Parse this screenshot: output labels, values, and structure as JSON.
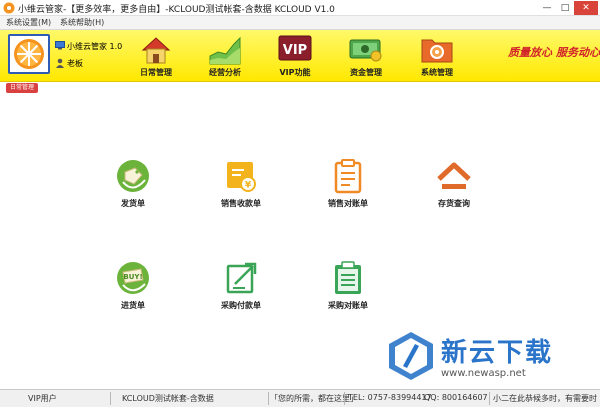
{
  "window": {
    "title": "小维云管家-【更多效率，更多自由】-KCLOUD测试帐套-含数据  KCLOUD V1.0",
    "min_glyph": "—",
    "max_glyph": "□",
    "close_glyph": "✕"
  },
  "menu": {
    "items": [
      "系统设置(M)",
      "系统帮助(H)"
    ]
  },
  "user": {
    "app_name": "小维云管家 1.0",
    "user_name": "老板"
  },
  "toolbar": {
    "buttons": [
      {
        "label": "日常管理",
        "icon": "house-icon"
      },
      {
        "label": "经营分析",
        "icon": "area-chart-icon"
      },
      {
        "label": "VIP功能",
        "icon": "vip-icon"
      },
      {
        "label": "资金管理",
        "icon": "money-icon"
      },
      {
        "label": "系统管理",
        "icon": "system-folder-icon"
      }
    ],
    "slogans": [
      "质量放心",
      "服务动心"
    ],
    "colors": {
      "background": "#ffef30",
      "slogan": "#d0232a"
    }
  },
  "tab": {
    "label": "日常管理"
  },
  "functions": [
    {
      "label": "发货单",
      "icon": "sale-tag-icon",
      "color": "#6bb33a"
    },
    {
      "label": "销售收款单",
      "icon": "yen-receipt-icon",
      "color": "#f2b31c"
    },
    {
      "label": "销售对账单",
      "icon": "clipboard-icon",
      "color": "#f08a24"
    },
    {
      "label": "存货查询",
      "icon": "house-arrow-icon",
      "color": "#e06a2a"
    },
    {
      "label": "进货单",
      "icon": "buy-tag-icon",
      "color": "#6bb33a"
    },
    {
      "label": "采购付款单",
      "icon": "edit-arrow-icon",
      "color": "#3aa556"
    },
    {
      "label": "采购对账单",
      "icon": "checklist-icon",
      "color": "#3aa556"
    }
  ],
  "watermark": {
    "text": "新云下载",
    "url": "www.newasp.net"
  },
  "status": {
    "user_type": "VIP用户",
    "account": "KCLOUD测试帐套-含数据",
    "motto": "「您的所需，都在这里」",
    "tel": "TEL: 0757-83994417",
    "qq": "QQ: 800164607",
    "ticker": "小二在此恭候多时，有需要时"
  }
}
